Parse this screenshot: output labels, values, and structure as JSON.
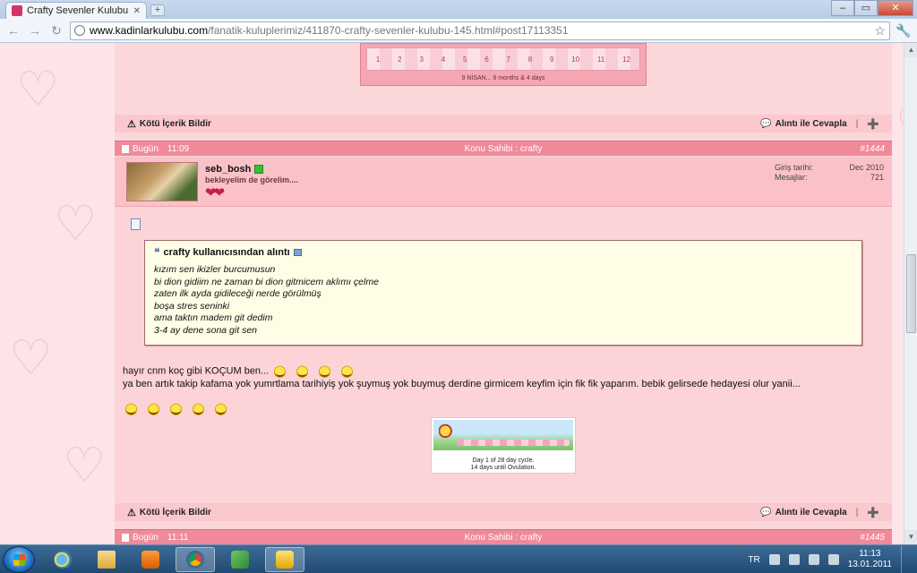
{
  "browser": {
    "tab_title": "Crafty Sevenler Kulubu",
    "url_host": "www.kadinlarkulubu.com",
    "url_path": "/fanatik-kuluplerimiz/411870-crafty-sevenler-kulubu-145.html#post17113351"
  },
  "prev_post": {
    "ruler_ticks": [
      "1",
      "2",
      "3",
      "4",
      "5",
      "6",
      "7",
      "8",
      "9",
      "10",
      "11",
      "12"
    ],
    "sig_caption": "9 NİSAN... 9 months & 4 days"
  },
  "actions": {
    "report": "Kötü İçerik Bildir",
    "quote_reply": "Alıntı ile Cevapla",
    "separator": "|"
  },
  "post": {
    "day": "Bugün",
    "time": "11:09",
    "owner": "Konu Sahibi : crafty",
    "number": "#1444",
    "username": "seb_bosh",
    "user_title": "bekleyelim de görelim....",
    "stats": [
      {
        "label": "Giriş tarihi:",
        "value": "Dec 2010"
      },
      {
        "label": "Mesajlar:",
        "value": "721"
      }
    ],
    "quote_author": "crafty kullanıcısından alıntı",
    "quote_lines": [
      "kızım sen ikizler burcumusun",
      "bi dion gidiim ne zaman bi dion gitmicem aklımı çelme",
      "zaten ilk ayda gidileceği nerde görülmüş",
      "boşa stres seninki",
      "ama taktın madem git dedim",
      "3-4 ay dene sona git sen"
    ],
    "message_line1": "hayır cnm koç gibi KOÇUM ben...",
    "message_line2": "ya ben artık takip kafama yok yumrtlama tarihiyiş yok şuymuş yok buymuş derdine girmicem keyfim için fik fik yaparım. bebik gelirsede hedayesi olur yanii...",
    "ticker_line1": "Day 1 of 28 day cycle.",
    "ticker_line2": "14 days until Ovulation."
  },
  "next_post": {
    "day": "Bugün",
    "time": "11:11",
    "owner": "Konu Sahibi : crafty",
    "number": "#1445"
  },
  "taskbar": {
    "language": "TR",
    "time": "11:13",
    "date": "13.01.2011"
  }
}
